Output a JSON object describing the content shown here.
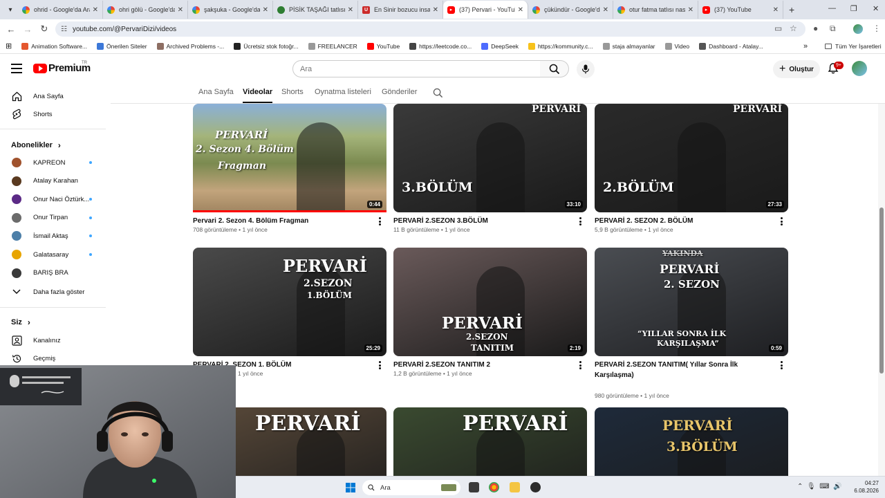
{
  "browser": {
    "tabs": [
      {
        "title": "ohrid - Google'da Ara",
        "favicon": "google",
        "active": false
      },
      {
        "title": "ohri gölü - Google'da Ara",
        "favicon": "google",
        "active": false
      },
      {
        "title": "şakşuka - Google'da Ara",
        "favicon": "google",
        "active": false
      },
      {
        "title": "PİSİK TAŞAĞI tatlısının tarifi",
        "favicon": "green",
        "active": false
      },
      {
        "title": "En Sinir bozucu insanlar",
        "favicon": "udemy",
        "active": false
      },
      {
        "title": "(37) Pervari - YouTube",
        "favicon": "youtube",
        "active": true
      },
      {
        "title": "çükündür - Google'da Ara",
        "favicon": "google",
        "active": false
      },
      {
        "title": "otur fatma tatlısı nasıl",
        "favicon": "google",
        "active": false
      },
      {
        "title": "(37) YouTube",
        "favicon": "youtube",
        "active": false
      }
    ],
    "url": "youtube.com/@PervariDizi/videos",
    "bookmarks": [
      {
        "label": "Animation Software...",
        "color": "#e4572e"
      },
      {
        "label": "Önerilen Siteler",
        "color": "#3c78d8"
      },
      {
        "label": "Archived Problems -...",
        "color": "#8d6e63"
      },
      {
        "label": "Ücretsiz stok fotoğr...",
        "color": "#222222"
      },
      {
        "label": "FREELANCER",
        "color": "#999999"
      },
      {
        "label": "YouTube",
        "color": "#ff0000"
      },
      {
        "label": "https://leetcode.co...",
        "color": "#444444"
      },
      {
        "label": "DeepSeek",
        "color": "#4d6bfe"
      },
      {
        "label": "https://kommunity.c...",
        "color": "#f7c21b"
      },
      {
        "label": "staja almayanlar",
        "color": "#999999"
      },
      {
        "label": "Video",
        "color": "#999999"
      },
      {
        "label": "Dashboard - Atalay...",
        "color": "#555555"
      }
    ],
    "bookmarks_overflow": "»",
    "all_bookmarks": "Tüm Yer İşaretleri"
  },
  "youtube": {
    "logo_text": "Premium",
    "logo_region": "TR",
    "search_placeholder": "Ara",
    "create_label": "Oluştur",
    "notif_badge": "9+"
  },
  "sidebar": {
    "main": [
      {
        "label": "Ana Sayfa",
        "icon": "home-icon"
      },
      {
        "label": "Shorts",
        "icon": "shorts-icon"
      }
    ],
    "subs_header": "Abonelikler",
    "subscriptions": [
      {
        "label": "KAPREON",
        "color": "#a0522d",
        "dot": true
      },
      {
        "label": "Atalay Karahan",
        "color": "#5a3a20",
        "dot": false
      },
      {
        "label": "Onur Naci Öztürk...",
        "color": "#5b2a86",
        "dot": true
      },
      {
        "label": "Onur Tirpan",
        "color": "#6b6b6b",
        "dot": true
      },
      {
        "label": "İsmail Aktaş",
        "color": "#4d7fa8",
        "dot": true
      },
      {
        "label": "Galatasaray",
        "color": "#e8a500",
        "dot": true
      },
      {
        "label": "BARIŞ BRA",
        "color": "#3a3a3a",
        "dot": false
      }
    ],
    "show_more": "Daha fazla göster",
    "you_header": "Siz",
    "you_items": [
      {
        "label": "Kanalınız",
        "icon": "channel-icon"
      },
      {
        "label": "Geçmiş",
        "icon": "history-icon"
      }
    ]
  },
  "channel_tabs": [
    {
      "label": "Ana Sayfa",
      "active": false
    },
    {
      "label": "Videolar",
      "active": true
    },
    {
      "label": "Shorts",
      "active": false
    },
    {
      "label": "Oynatma listeleri",
      "active": false
    },
    {
      "label": "Gönderiler",
      "active": false
    }
  ],
  "videos": [
    {
      "title": "Pervari 2. Sezon 4. Bölüm Fragman",
      "meta": "708 görüntüleme • 1 yıl önce",
      "duration": "0:44",
      "thumb_lines": [
        "PERVARİ",
        "2. Sezon 4. Bölüm",
        "Fragman"
      ],
      "bg": "#7a8a55",
      "progress": 1.0
    },
    {
      "title": "PERVARİ 2.SEZON 3.BÖLÜM",
      "meta": "11 B görüntüleme • 1 yıl önce",
      "duration": "33:10",
      "thumb_lines": [
        "3.BÖLÜM",
        "PERVARİ"
      ],
      "bg": "#3a3a3a",
      "progress": 0
    },
    {
      "title": "PERVARİ 2. SEZON 2. BÖLÜM",
      "meta": "5,9 B görüntüleme • 1 yıl önce",
      "duration": "27:33",
      "thumb_lines": [
        "2.BÖLÜM",
        "PERVARİ"
      ],
      "bg": "#2a2a2a",
      "progress": 0
    },
    {
      "title": "PERVARİ 2. SEZON 1. BÖLÜM",
      "meta": "1 yıl önce",
      "duration": "25:29",
      "thumb_lines": [
        "PERVARİ",
        "2.SEZON",
        "1.BÖLÜM"
      ],
      "bg": "#4a4a4a",
      "progress": 0
    },
    {
      "title": "PERVARİ 2.SEZON TANITIM 2",
      "meta": "1,2 B görüntüleme • 1 yıl önce",
      "duration": "2:19",
      "thumb_lines": [
        "PERVARİ",
        "2.SEZON",
        "TANITIM"
      ],
      "bg": "#6a5a5a",
      "progress": 0
    },
    {
      "title": "PERVARİ 2.SEZON TANITIM( Yıllar Sonra İlk Karşılaşma)",
      "meta": "980 görüntüleme • 1 yıl önce",
      "duration": "0:59",
      "thumb_lines": [
        "YAKINDA",
        "PERVARİ",
        "2. SEZON",
        "“YILLAR SONRA İLK",
        "KARŞILAŞMA”"
      ],
      "bg": "#3a3c40",
      "progress": 0
    },
    {
      "title": "",
      "meta": "",
      "duration": "",
      "thumb_lines": [
        "PERVARİ"
      ],
      "bg": "#5a4a3a",
      "progress": 0
    },
    {
      "title": "",
      "meta": "",
      "duration": "",
      "thumb_lines": [
        "PERVARİ"
      ],
      "bg": "#3a4a30",
      "progress": 0
    },
    {
      "title": "",
      "meta": "",
      "duration": "",
      "thumb_lines": [
        "PERVARİ",
        "3.BÖLÜM"
      ],
      "bg": "#1e2a3a",
      "progress": 0
    }
  ],
  "taskbar": {
    "search_label": "Ara",
    "time": "04:27",
    "date": "6.08.2026"
  },
  "colors": {
    "yt_red": "#ff0000",
    "progress_red": "#ff0000",
    "sub_dot": "#3ea6ff"
  }
}
